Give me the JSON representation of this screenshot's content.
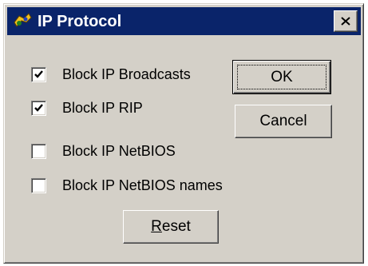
{
  "window": {
    "title": "IP Protocol",
    "icon": "app-icon",
    "close_glyph": "✕"
  },
  "options": [
    {
      "label": "Block IP Broadcasts",
      "checked": true
    },
    {
      "label": "Block IP RIP",
      "checked": true
    },
    {
      "label": "Block IP NetBIOS",
      "checked": false
    },
    {
      "label": "Block IP NetBIOS names",
      "checked": false
    }
  ],
  "buttons": {
    "ok_label": "OK",
    "cancel_label": "Cancel",
    "reset_mnemonic": "R",
    "reset_rest": "eset"
  }
}
